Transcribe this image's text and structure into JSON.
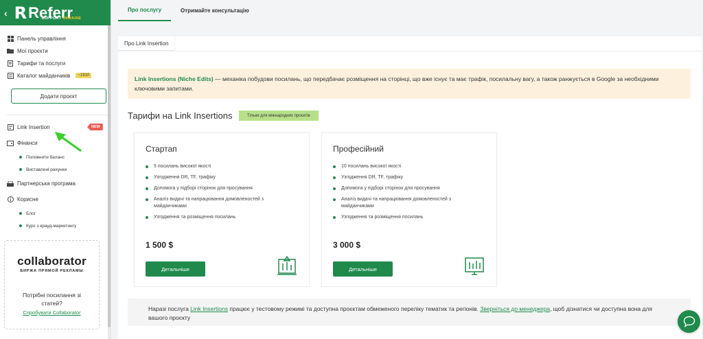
{
  "brand": {
    "back_glyph": "‹",
    "logo_letter": "R",
    "logo_word": "Referr",
    "logo_support": "SUPPORT",
    "logo_ukraine": "UKRAINE",
    "color": "#1f8a4c"
  },
  "sidebar": {
    "items": [
      {
        "label": "Панель управління",
        "icon": "dashboard-icon"
      },
      {
        "label": "Мої проєкти",
        "icon": "folder-icon"
      },
      {
        "label": "Тарифи та послуги",
        "icon": "document-icon"
      },
      {
        "label": "Каталог майданчиків",
        "icon": "catalog-icon",
        "badge": "~1910"
      }
    ],
    "add_project": "Додати проєкт",
    "link_insertion": "Link Insertion",
    "new_badge": "NEW",
    "finance": "Фінанси",
    "finance_sub": [
      "Поповнити баланс",
      "Виставлені рахунки"
    ],
    "partner": "Партнерська програма",
    "useful": "Корисне",
    "useful_sub": [
      "Блог",
      "Курс з крауд-маркетингу"
    ],
    "promo": {
      "logo": "collaborator",
      "tagline": "БИРЖА ПРЯМОЙ РЕКЛАМЫ",
      "text": "Потрібні посилання зі статей?",
      "link": "Спробувати Collaborator"
    }
  },
  "tabs": [
    "Про послугу",
    "Отримайте консультацію"
  ],
  "inner_tab": "Про Link Insertion",
  "info": {
    "bold": "Link Insertions (Niche Edits)",
    "text": " — механіка побудови посилань, що передбачає розміщення на сторінці, що вже існує та має трафік, посилальну вагу, а також ранжується в Google за необхідними ключовими запитами."
  },
  "tariffs_title": "Тарифи на Link Insertions",
  "intl_badge": "Тільки для міжнародних проєктів",
  "plans": [
    {
      "name": "Стартап",
      "features": [
        "5 посилань високої якості",
        "Узгодження DR, TF, трафіку",
        "Допомога у підборі сторінок для просування",
        "Аналіз видачі та напрацювання домовленостей з майданчиками",
        "Узгодження та розміщення посилань"
      ],
      "price": "1 500 $",
      "button": "Детальніше"
    },
    {
      "name": "Професійний",
      "features": [
        "10 посилань високої якості",
        "Узгодження DR, TF, трафіку",
        "Допомога у підборі сторінок для просування",
        "Аналіз видачі та напрацювання домовленостей з майданчиками",
        "Узгодження та розміщення посилань"
      ],
      "price": "3 000 $",
      "button": "Детальніше"
    }
  ],
  "note": {
    "t1": "Наразі послуга ",
    "link1": "Link Insertions",
    "t2": " працює у тестовому режимі та доступна проєктам обмеженого переліку тематик та регіонів. ",
    "link2": "Зверніться до менеджера",
    "t3": ", щоб дізнатися чи доступна вона для вашого проєкту"
  },
  "chat_icon": "chat-bubble-icon"
}
